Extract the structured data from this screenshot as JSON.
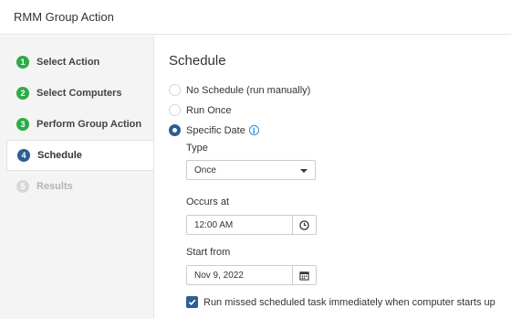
{
  "header": {
    "title": "RMM Group Action"
  },
  "steps": [
    {
      "num": "1",
      "label": "Select Action",
      "state": "done"
    },
    {
      "num": "2",
      "label": "Select Computers",
      "state": "done"
    },
    {
      "num": "3",
      "label": "Perform Group Action",
      "state": "done"
    },
    {
      "num": "4",
      "label": "Schedule",
      "state": "active"
    },
    {
      "num": "5",
      "label": "Results",
      "state": "disabled"
    }
  ],
  "schedule": {
    "title": "Schedule",
    "options": [
      {
        "label": "No Schedule (run manually)",
        "checked": false
      },
      {
        "label": "Run Once",
        "checked": false
      },
      {
        "label": "Specific Date",
        "checked": true
      }
    ],
    "info_icon": "info-icon",
    "type_label": "Type",
    "type_value": "Once",
    "occurs_label": "Occurs at",
    "occurs_value": "12:00 AM",
    "occurs_icon": "clock-icon",
    "start_label": "Start from",
    "start_value": "Nov 9, 2022",
    "start_icon": "calendar-icon",
    "missed_label": "Run missed scheduled task immediately when computer starts up",
    "missed_checked": true
  },
  "colors": {
    "done": "#2dab47",
    "active": "#2b5f93",
    "disabled": "#d8d8d8",
    "info": "#2c8ad6"
  }
}
